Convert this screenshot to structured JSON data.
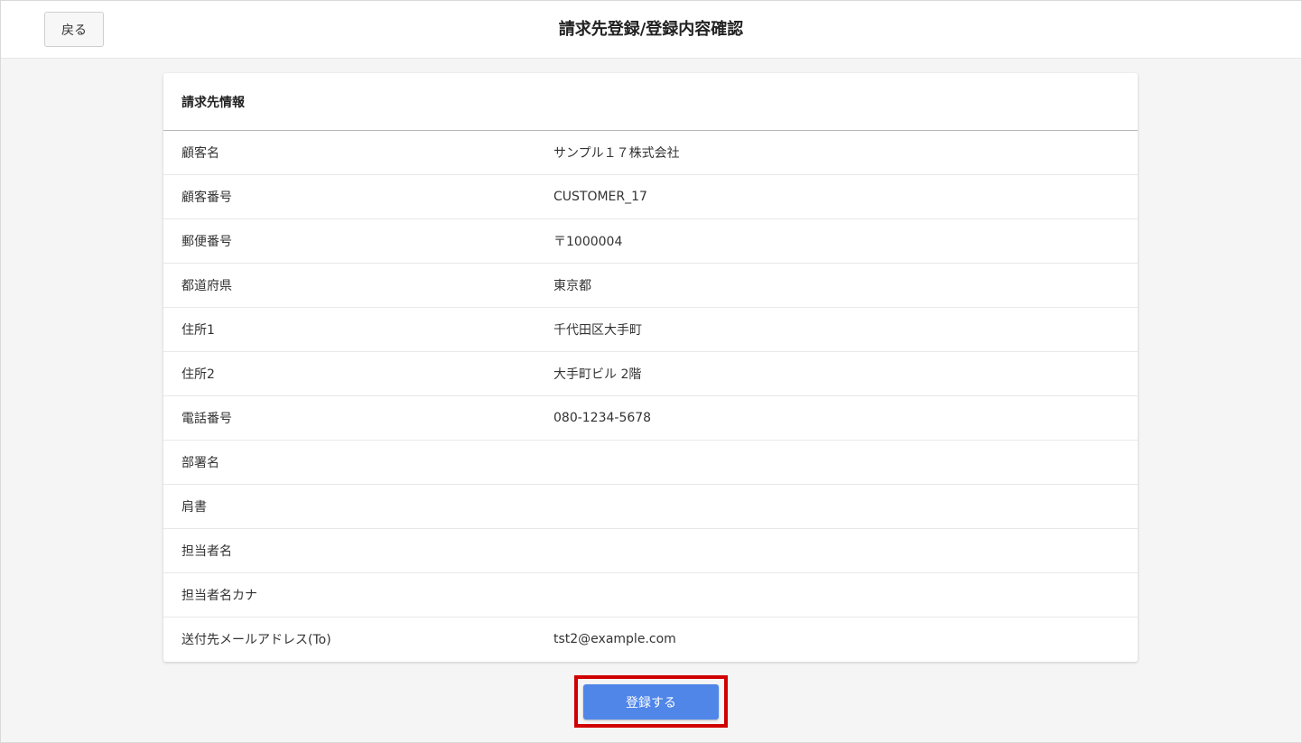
{
  "header": {
    "back_label": "戻る",
    "title": "請求先登録/登録内容確認"
  },
  "card": {
    "title": "請求先情報",
    "rows": [
      {
        "label": "顧客名",
        "value": "サンプル１７株式会社"
      },
      {
        "label": "顧客番号",
        "value": "CUSTOMER_17"
      },
      {
        "label": "郵便番号",
        "value": "〒1000004"
      },
      {
        "label": "都道府県",
        "value": "東京都"
      },
      {
        "label": "住所1",
        "value": "千代田区大手町"
      },
      {
        "label": "住所2",
        "value": "大手町ビル 2階"
      },
      {
        "label": "電話番号",
        "value": "080-1234-5678"
      },
      {
        "label": "部署名",
        "value": ""
      },
      {
        "label": "肩書",
        "value": ""
      },
      {
        "label": "担当者名",
        "value": ""
      },
      {
        "label": "担当者名カナ",
        "value": ""
      },
      {
        "label": "送付先メールアドレス(To)",
        "value": "tst2@example.com"
      }
    ]
  },
  "footer": {
    "register_label": "登録する"
  },
  "colors": {
    "primary_button": "#4f86e8",
    "highlight_border": "#d10000",
    "background": "#f5f5f5"
  }
}
